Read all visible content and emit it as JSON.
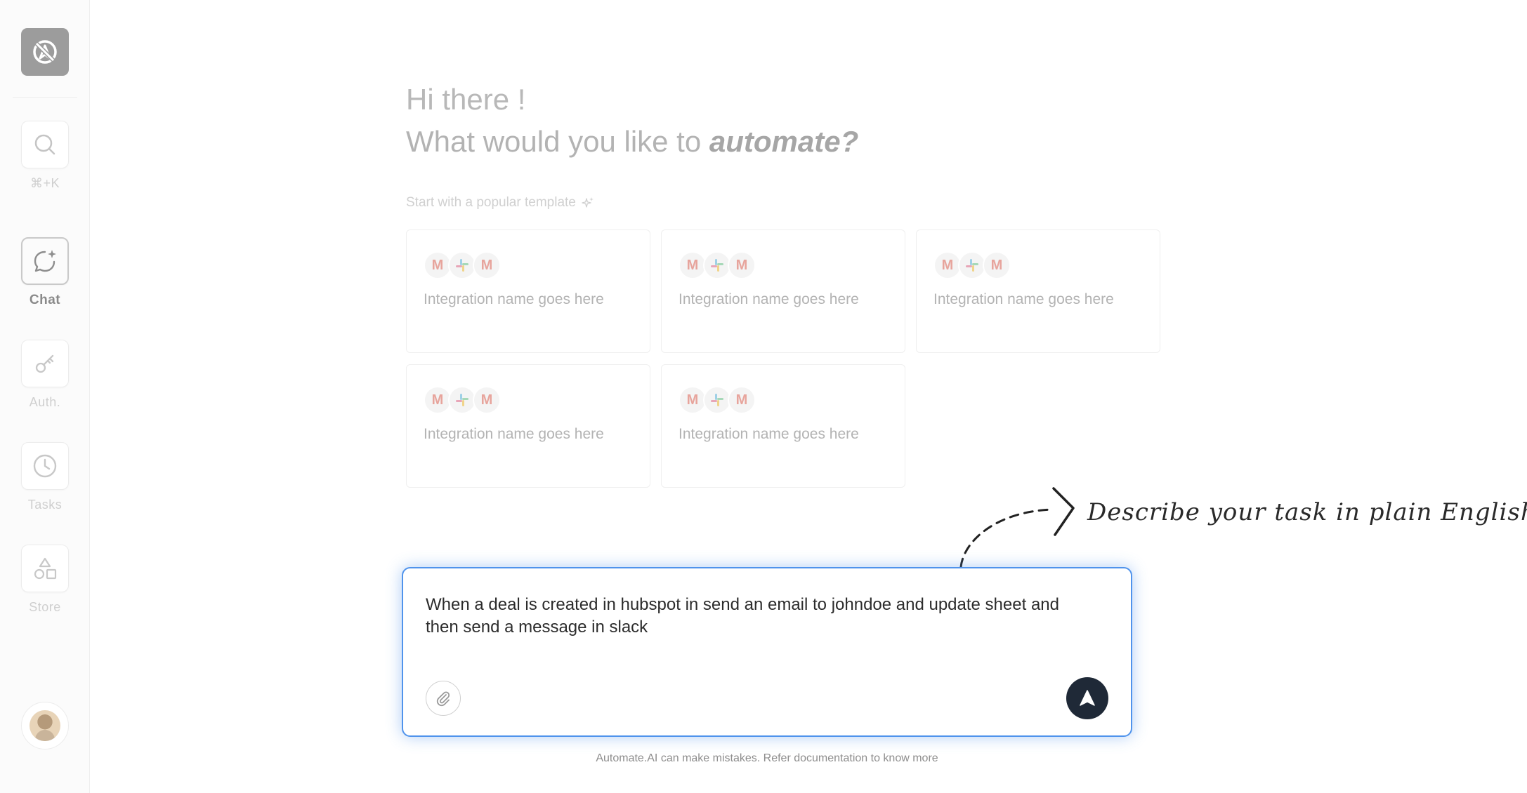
{
  "sidebar": {
    "logo_icon": "automation-logo-icon",
    "items": [
      {
        "id": "search",
        "icon": "search-icon",
        "label": "⌘+K"
      },
      {
        "id": "chat",
        "icon": "chat-sparkle-icon",
        "label": "Chat",
        "active": true
      },
      {
        "id": "auth",
        "icon": "key-icon",
        "label": "Auth."
      },
      {
        "id": "tasks",
        "icon": "clock-icon",
        "label": "Tasks"
      },
      {
        "id": "store",
        "icon": "shapes-icon",
        "label": "Store"
      }
    ],
    "avatar_icon": "user-avatar"
  },
  "main": {
    "greeting": "Hi there !",
    "question_prefix": "What would you like to",
    "question_emphasis": "automate?",
    "templates_label": "Start with a popular template",
    "templates": [
      {
        "title": "Integration name goes here",
        "icons": [
          "gmail-icon",
          "slack-icon",
          "gmail-icon"
        ]
      },
      {
        "title": "Integration name goes here",
        "icons": [
          "gmail-icon",
          "slack-icon",
          "gmail-icon"
        ]
      },
      {
        "title": "Integration name goes here",
        "icons": [
          "gmail-icon",
          "slack-icon",
          "gmail-icon"
        ]
      },
      {
        "title": "Integration name goes here",
        "icons": [
          "gmail-icon",
          "slack-icon",
          "gmail-icon"
        ]
      },
      {
        "title": "Integration name goes here",
        "icons": [
          "gmail-icon",
          "slack-icon",
          "gmail-icon"
        ]
      }
    ]
  },
  "annotation": "Describe your task in plain English.",
  "prompt": {
    "value": "When a deal is created in hubspot in send an email to johndoe and update sheet and then send a message in slack",
    "attach_icon": "paperclip-icon",
    "send_icon": "send-arrow-icon"
  },
  "disclaimer": "Automate.AI can make mistakes. Refer documentation to know more",
  "colors": {
    "accent_blue": "#4f93ec",
    "send_button": "#1f2937",
    "logo_bg": "#9c9c9c"
  }
}
